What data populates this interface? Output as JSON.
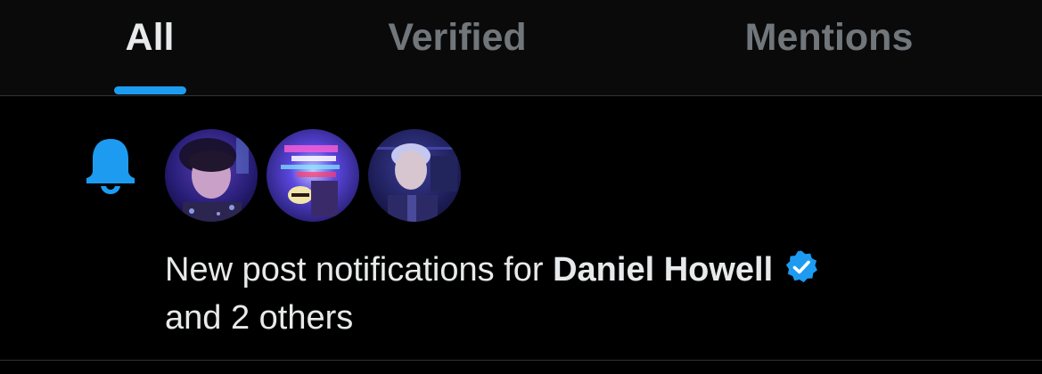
{
  "tabs": [
    {
      "label": "All",
      "active": true
    },
    {
      "label": "Verified",
      "active": false
    },
    {
      "label": "Mentions",
      "active": false
    }
  ],
  "colors": {
    "accent": "#1d9bf0",
    "text_primary": "#e7e9ea",
    "text_secondary": "#71767b",
    "background": "#000000"
  },
  "notification": {
    "icon": "bell-icon",
    "avatars": [
      "user-avatar",
      "user-avatar",
      "user-avatar"
    ],
    "text_prefix": "New post notifications for ",
    "user_name": "Daniel Howell",
    "verified_icon": "verified-badge-icon",
    "text_suffix": "and 2 others"
  }
}
